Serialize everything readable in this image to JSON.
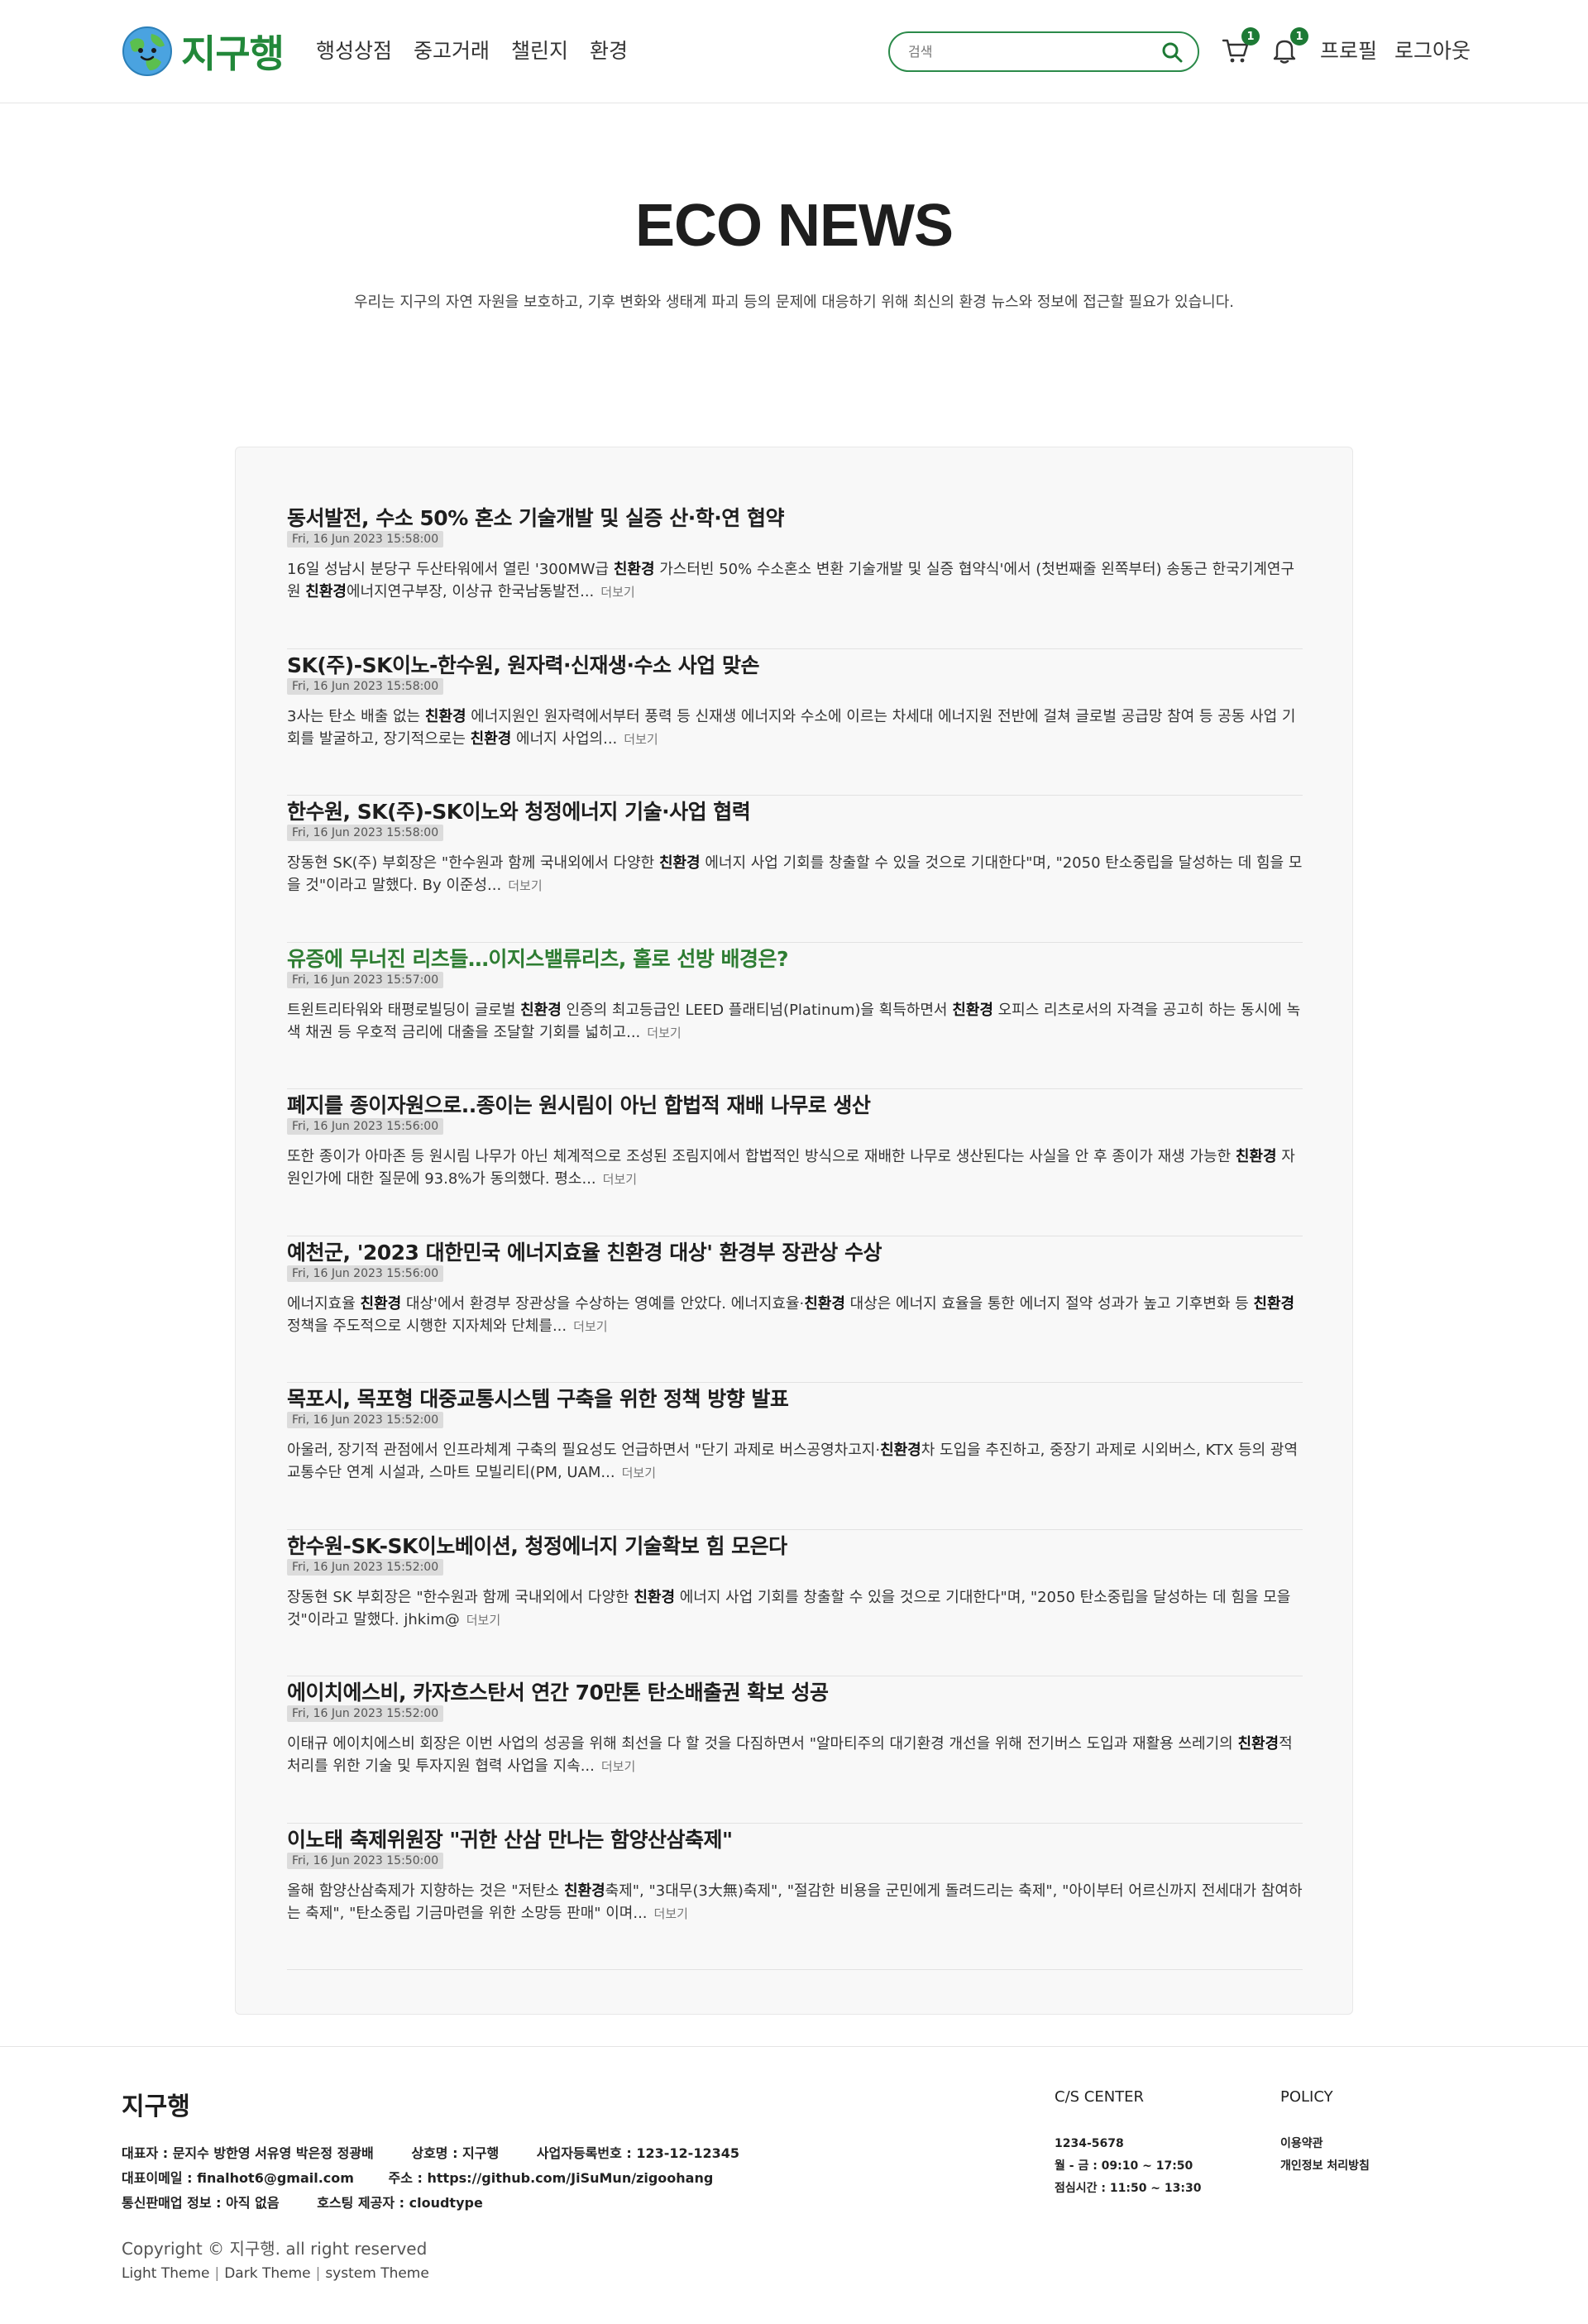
{
  "header": {
    "logo_text": "지구행",
    "nav": [
      {
        "label": "행성상점"
      },
      {
        "label": "중고거래"
      },
      {
        "label": "챌린지"
      },
      {
        "label": "환경"
      }
    ],
    "search_placeholder": "검색",
    "cart_badge": "1",
    "alarm_badge": "1",
    "profile_label": "프로필",
    "logout_label": "로그아웃",
    "accent_color": "#2b8a4a"
  },
  "hero": {
    "title": "ECO NEWS",
    "subtitle": "우리는 지구의 자연 자원을 보호하고, 기후 변화와 생태계 파괴 등의 문제에 대응하기 위해 최신의 환경 뉴스와 정보에 접근할 필요가 있습니다."
  },
  "news": {
    "more_label": "더보기",
    "items": [
      {
        "title": "동서발전, 수소 50% 혼소 기술개발 및 실증 산·학·연 협약",
        "date": "Fri, 16 Jun 2023 15:58:00",
        "parts": [
          "16일 성남시 분당구 두산타워에서 열린 '300MW급 ",
          "친환경",
          " 가스터빈 50% 수소혼소 변환 기술개발 및 실증 협약식'에서 (첫번째줄 왼쪽부터) 송동근 한국기계연구원 ",
          "친환경",
          "에너지연구부장, 이상규 한국남동발전..."
        ]
      },
      {
        "title": "SK(주)-SK이노-한수원, 원자력·신재생·수소 사업 맞손",
        "date": "Fri, 16 Jun 2023 15:58:00",
        "parts": [
          "3사는 탄소 배출 없는 ",
          "친환경",
          " 에너지원인 원자력에서부터 풍력 등 신재생 에너지와 수소에 이르는 차세대 에너지원 전반에 걸쳐 글로벌 공급망 참여 등 공동 사업 기회를 발굴하고, 장기적으로는 ",
          "친환경",
          " 에너지 사업의..."
        ]
      },
      {
        "title": "한수원, SK(주)-SK이노와 청정에너지 기술·사업 협력",
        "date": "Fri, 16 Jun 2023 15:58:00",
        "parts": [
          "장동현 SK(주) 부회장은 \"한수원과 함께 국내외에서 다양한 ",
          "친환경",
          " 에너지 사업 기회를 창출할 수 있을 것으로 기대한다\"며, \"2050 탄소중립을 달성하는 데 힘을 모을 것\"이라고 말했다. By 이준성..."
        ]
      },
      {
        "title": "유증에 무너진 리츠들…이지스밸류리츠, 홀로 선방 배경은?",
        "date": "Fri, 16 Jun 2023 15:57:00",
        "parts": [
          "트윈트리타워와 태평로빌딩이 글로벌 ",
          "친환경",
          " 인증의 최고등급인 LEED 플래티넘(Platinum)을 획득하면서 ",
          "친환경",
          " 오피스 리츠로서의 자격을 공고히 하는 동시에 녹색 채권 등 우호적 금리에 대출을 조달할 기회를 넓히고..."
        ]
      },
      {
        "title": "폐지를 종이자원으로..종이는 원시림이 아닌 합법적 재배 나무로 생산",
        "date": "Fri, 16 Jun 2023 15:56:00",
        "parts": [
          "또한 종이가 아마존 등 원시림 나무가 아닌 체계적으로 조성된 조림지에서 합법적인 방식으로 재배한 나무로 생산된다는 사실을 안 후 종이가 재생 가능한 ",
          "친환경",
          " 자원인가에 대한 질문에 93.8%가 동의했다. 평소..."
        ]
      },
      {
        "title": "예천군, '2023 대한민국 에너지효율 친환경 대상' 환경부 장관상 수상",
        "date": "Fri, 16 Jun 2023 15:56:00",
        "parts": [
          "에너지효율 ",
          "친환경",
          " 대상'에서 환경부 장관상을 수상하는 영예를 안았다. 에너지효율·",
          "친환경",
          " 대상은 에너지 효율을 통한 에너지 절약 성과가 높고 기후변화 등 ",
          "친환경",
          " 정책을 주도적으로 시행한 지자체와 단체를..."
        ]
      },
      {
        "title": "목포시, 목포형 대중교통시스템 구축을 위한 정책 방향 발표",
        "date": "Fri, 16 Jun 2023 15:52:00",
        "parts": [
          "아울러, 장기적 관점에서 인프라체계 구축의 필요성도 언급하면서 \"단기 과제로 버스공영차고지·",
          "친환경",
          "차 도입을 추진하고, 중장기 과제로 시외버스, KTX 등의 광역 교통수단 연계 시설과, 스마트 모빌리티(PM, UAM..."
        ]
      },
      {
        "title": "한수원-SK-SK이노베이션, 청정에너지 기술확보 힘 모은다",
        "date": "Fri, 16 Jun 2023 15:52:00",
        "parts": [
          "장동현 SK 부회장은 \"한수원과 함께 국내외에서 다양한 ",
          "친환경",
          " 에너지 사업 기회를 창출할 수 있을 것으로 기대한다\"며, \"2050 탄소중립을 달성하는 데 힘을 모을 것\"이라고 말했다. jhkim@"
        ]
      },
      {
        "title": "에이치에스비, 카자흐스탄서 연간 70만톤 탄소배출권 확보 성공",
        "date": "Fri, 16 Jun 2023 15:52:00",
        "parts": [
          "이태규 에이치에스비 회장은 이번 사업의 성공을 위해 최선을 다 할 것을 다짐하면서 \"알마티주의 대기환경 개선을 위해 전기버스 도입과 재활용 쓰레기의 ",
          "친환경",
          "적 처리를 위한 기술 및 투자지원 협력 사업을 지속..."
        ]
      },
      {
        "title": "이노태 축제위원장 \"귀한 산삼 만나는 함양산삼축제\"",
        "date": "Fri, 16 Jun 2023 15:50:00",
        "parts": [
          "올해 함양산삼축제가 지향하는 것은 \"저탄소 ",
          "친환경",
          "축제\", \"3대무(3大無)축제\", \"절감한 비용을 군민에게 돌려드리는 축제\", \"아이부터 어르신까지 전세대가 참여하는 축제\", \"탄소중립 기금마련을 위한 소망등 판매\" 이며..."
        ]
      }
    ]
  },
  "footer": {
    "brand": "지구행",
    "ceo": "대표자 : 문지수 방한영 서유영 박은정 정광배",
    "company": "상호명 : 지구행",
    "biz_no": "사업자등록번호 : 123-12-12345",
    "email": "대표이메일 : finalhot6@gmail.com",
    "address": "주소 : https://github.com/JiSuMun/zigoohang",
    "telecom": "통신판매업 정보 : 아직 없음",
    "hosting": "호스팅 제공자 : cloudtype",
    "copyright": "Copyright © 지구행. all right reserved",
    "themes": [
      "Light Theme",
      "Dark Theme",
      "system Theme"
    ],
    "cs_title": "C/S CENTER",
    "cs_phone": "1234-5678",
    "cs_hours": "월 - 금 : 09:10 ~ 17:50",
    "cs_lunch": "점심시간 : 11:50 ~ 13:30",
    "policy_title": "POLICY",
    "policy_terms": "이용약관",
    "policy_privacy": "개인정보 처리방침"
  }
}
